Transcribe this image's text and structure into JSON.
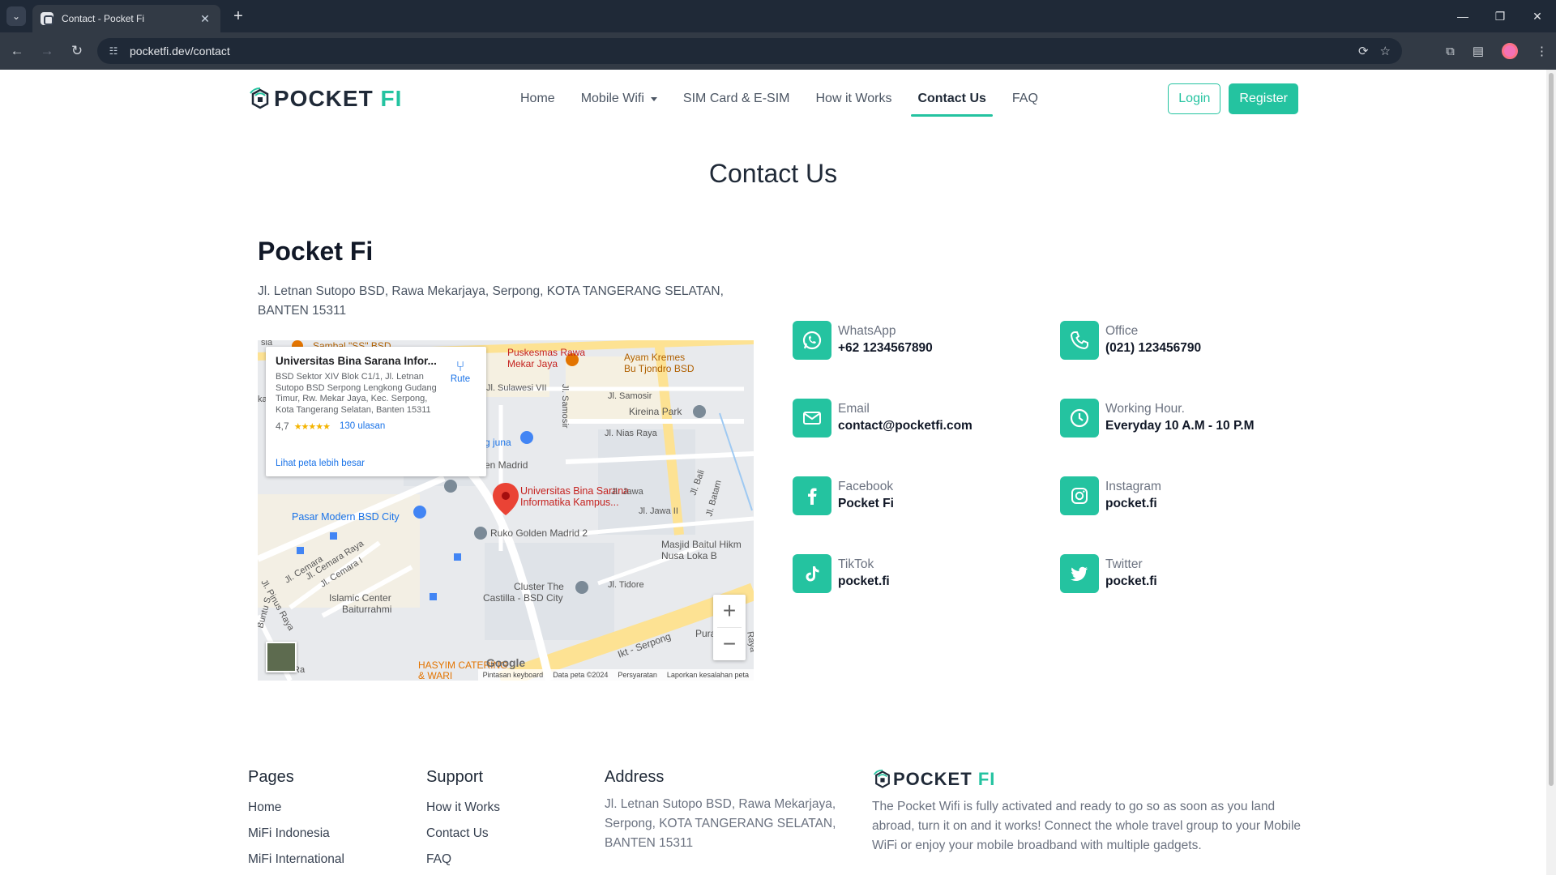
{
  "browser": {
    "tab_title": "Contact - Pocket Fi",
    "url": "pocketfi.dev/contact",
    "new_tab": "+",
    "close_tab": "✕"
  },
  "nav": {
    "logo_text": "POCKET",
    "logo_accent": "FI",
    "menu": [
      {
        "label": "Home"
      },
      {
        "label": "Mobile Wifi"
      },
      {
        "label": "SIM Card & E-SIM"
      },
      {
        "label": "How it Works"
      },
      {
        "label": "Contact Us"
      },
      {
        "label": "FAQ"
      }
    ],
    "login": "Login",
    "register": "Register"
  },
  "page": {
    "title": "Contact Us",
    "company": "Pocket Fi",
    "address": "Jl. Letnan Sutopo BSD, Rawa Mekarjaya, Serpong, KOTA TANGERANG SELATAN, BANTEN 15311"
  },
  "map": {
    "card_title": "Universitas Bina Sarana Infor...",
    "card_address": "BSD Sektor XIV Blok C1/1, Jl. Letnan Sutopo BSD Serpong Lengkong Gudang Timur, Rw. Mekar Jaya, Kec. Serpong, Kota Tangerang Selatan, Banten 15311",
    "rating": "4,7",
    "stars": "★★★★★",
    "reviews": "130 ulasan",
    "larger_map": "Lihat peta lebih besar",
    "route": "Rute",
    "zoom_in": "+",
    "zoom_out": "−",
    "google": "Google",
    "footer": [
      "Pintasan keyboard",
      "Data peta ©2024",
      "Persyaratan",
      "Laporkan kesalahan peta"
    ],
    "labels": {
      "pin": "Universitas Bina Sarana",
      "pin2": "Informatika Kampus...",
      "sambal": "Sambal \"SS\" BSD",
      "puskesmas1": "Puskesmas Rawa",
      "puskesmas2": "Mekar Jaya",
      "ayam1": "Ayam Kremes",
      "ayam2": "Bu Tjondro BSD",
      "kireina": "Kireina Park",
      "sulawesi": "Jl. Sulawesi VII",
      "samosir": "Jl. Samosir",
      "nias": "Jl. Nias Raya",
      "samosir_v": "Jl. Samosir",
      "bali": "Jl. Bali",
      "batam": "Jl. Batam",
      "jawa": "Jl. Jawa",
      "jawa2": "Jl. Jawa II",
      "juna": "g juna",
      "madrid": "en Madrid",
      "pasar": "Pasar Modern BSD City",
      "ruko": "Ruko Golden Madrid 2",
      "masjid1": "Masjid Baitul Hikm",
      "masjid2": "Nusa Loka B",
      "cluster1": "Cluster The",
      "cluster2": "Castilla - BSD City",
      "tidore": "Jl. Tidore",
      "cemara1": "Jl. Cemara",
      "cemara2": "Jl. Cemara Raya",
      "cemara3": "Jl. Cemara I",
      "islamic1": "Islamic Center",
      "islamic2": "Baiturrahmi",
      "pinus": "Jl. Pinus Raya",
      "buntu": "Buntu S",
      "hasyim1": "HASYIM CATERING",
      "hasyim2": "& WARI",
      "serpong": "Ikt - Serpong",
      "pura": "Pura",
      "raya": "Raya",
      "jl_ra": "Jl. Ra",
      "sia": "sia",
      "ka": "ka"
    }
  },
  "contacts": [
    {
      "label": "WhatsApp",
      "value": "+62 1234567890",
      "icon": "whatsapp-icon"
    },
    {
      "label": "Office",
      "value": "(021) 123456790",
      "icon": "phone-icon"
    },
    {
      "label": "Email",
      "value": "contact@pocketfi.com",
      "icon": "mail-icon"
    },
    {
      "label": "Working Hour.",
      "value": "Everyday 10 A.M - 10 P.M",
      "icon": "clock-icon"
    },
    {
      "label": "Facebook",
      "value": "Pocket Fi",
      "icon": "facebook-icon"
    },
    {
      "label": "Instagram",
      "value": "pocket.fi",
      "icon": "instagram-icon"
    },
    {
      "label": "TikTok",
      "value": "pocket.fi",
      "icon": "tiktok-icon"
    },
    {
      "label": "Twitter",
      "value": "pocket.fi",
      "icon": "twitter-icon"
    }
  ],
  "footer": {
    "pages_head": "Pages",
    "pages": [
      "Home",
      "MiFi Indonesia",
      "MiFi International"
    ],
    "support_head": "Support",
    "support": [
      "How it Works",
      "Contact Us",
      "FAQ"
    ],
    "address_head": "Address",
    "address": "Jl. Letnan Sutopo BSD, Rawa Mekarjaya, Serpong, KOTA TANGERANG SELATAN, BANTEN 15311",
    "logo_text": "POCKET",
    "logo_accent": "FI",
    "about": "The Pocket Wifi is fully activated and ready to go so as soon as you land abroad, turn it on and it works! Connect the whole travel group to your Mobile WiFi or enjoy your mobile broadband with multiple gadgets."
  },
  "colors": {
    "accent": "#24c3a0",
    "text": "#1f2937"
  }
}
